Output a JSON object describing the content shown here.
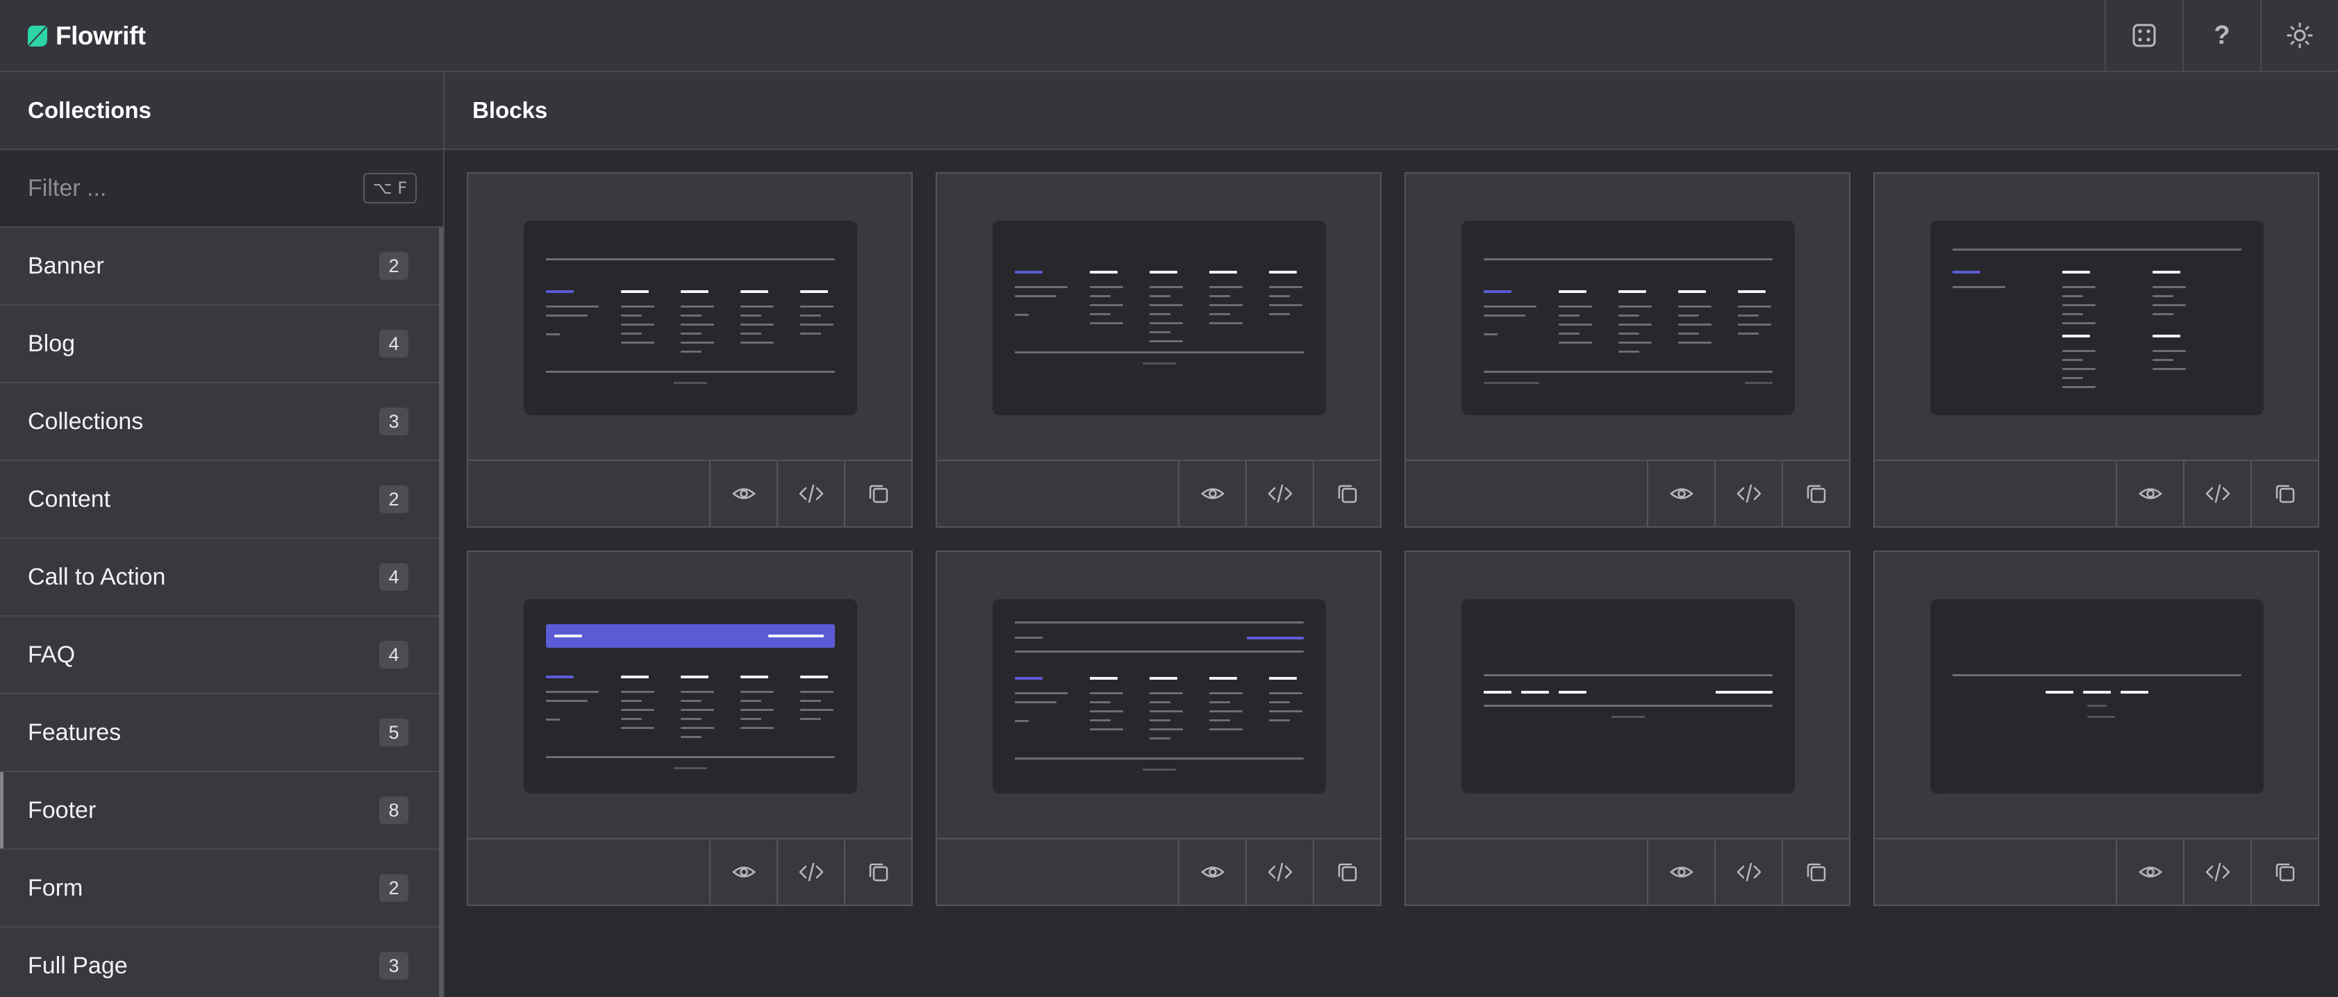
{
  "app": {
    "name": "Flowrift",
    "brand_color": "#2dd4a7"
  },
  "topbar": {
    "actions": [
      {
        "icon": "dice-icon"
      },
      {
        "icon": "help-icon",
        "glyph": "?"
      },
      {
        "icon": "sun-icon"
      }
    ]
  },
  "sidebar": {
    "title": "Collections",
    "filter": {
      "placeholder": "Filter ...",
      "shortcut": "⌥ F",
      "value": ""
    },
    "items": [
      {
        "label": "Banner",
        "count": "2"
      },
      {
        "label": "Blog",
        "count": "4"
      },
      {
        "label": "Collections",
        "count": "3"
      },
      {
        "label": "Content",
        "count": "2"
      },
      {
        "label": "Call to Action",
        "count": "4"
      },
      {
        "label": "FAQ",
        "count": "4"
      },
      {
        "label": "Features",
        "count": "5"
      },
      {
        "label": "Footer",
        "count": "8",
        "active": true
      },
      {
        "label": "Form",
        "count": "2"
      },
      {
        "label": "Full Page",
        "count": "3"
      }
    ]
  },
  "main": {
    "title": "Blocks",
    "accent_color": "#5b5bd6",
    "card_actions": [
      "eye-icon",
      "code-icon",
      "copy-icon"
    ],
    "cards": [
      {
        "variant": "footer-columns-topline"
      },
      {
        "variant": "footer-columns-brand"
      },
      {
        "variant": "footer-columns-split-bottom"
      },
      {
        "variant": "footer-two-column-stack"
      },
      {
        "variant": "footer-accent-banner"
      },
      {
        "variant": "footer-topbar-columns"
      },
      {
        "variant": "footer-simple-links-right"
      },
      {
        "variant": "footer-centered-links"
      }
    ]
  }
}
